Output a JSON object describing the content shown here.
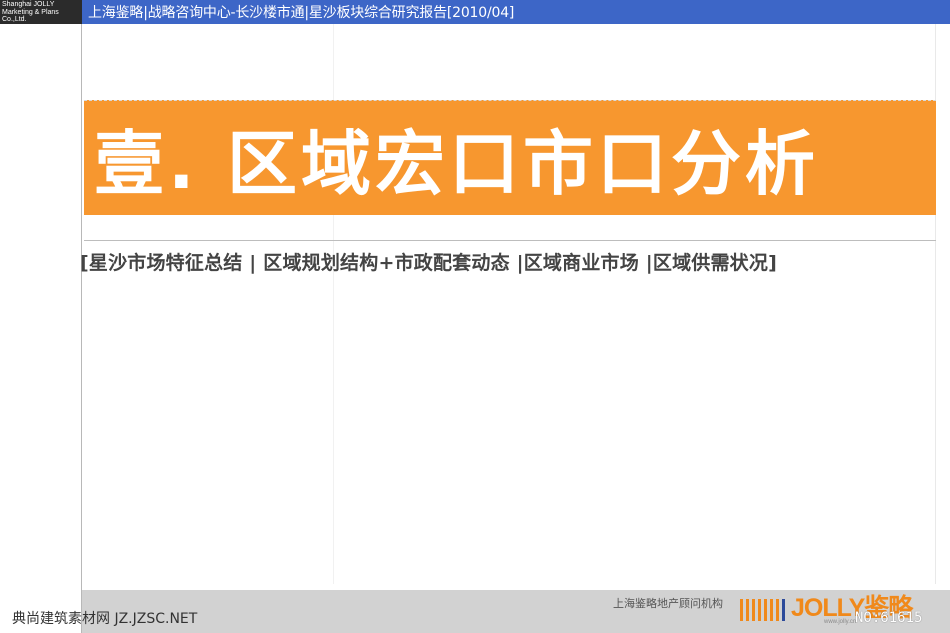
{
  "corner_logo": {
    "line1": "Shanghai JOLLY",
    "line2": "Marketing & Plans",
    "line3": "Co.,Ltd."
  },
  "header": {
    "title": "上海鉴略|战略咨询中心-长沙楼市通|星沙板块综合研究报告[2010/04]"
  },
  "slide": {
    "chapter_title": "壹. 区域宏口市口分析",
    "section_nav": "[星沙市场特征总结 | 区域规划结构+市政配套动态 |区域商业市场 |区域供需状况]"
  },
  "footer": {
    "company": "上海鉴略地产顾问机构",
    "logo_word": "JOLLY鉴略",
    "logo_url": "www.jolly.cn",
    "watermark": "典尚建筑素材网 JZ.JZSC.NET",
    "slide_number": "NO:61615"
  },
  "colors": {
    "header_blue": "#3d66c7",
    "title_orange": "#f7972f",
    "logo_orange": "#f0891b",
    "footer_gray": "#d2d2d2"
  }
}
